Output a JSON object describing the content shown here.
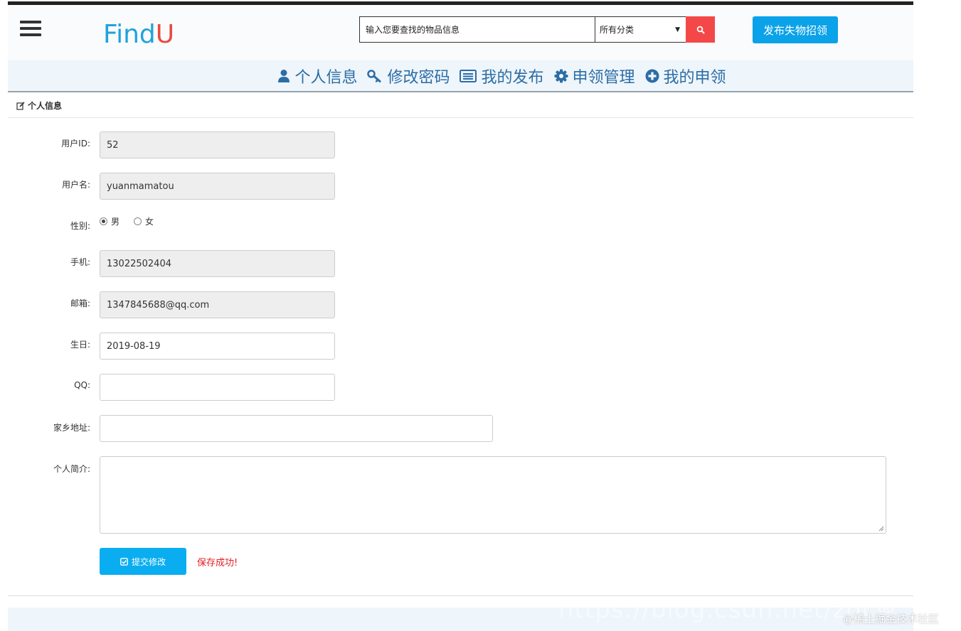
{
  "header": {
    "logo_find": "Find",
    "logo_u": "U",
    "search_placeholder": "输入您要查找的物品信息",
    "category_selected": "所有分类",
    "publish_button": "发布失物招领"
  },
  "nav": {
    "items": [
      {
        "label": "个人信息",
        "icon": "user-icon"
      },
      {
        "label": "修改密码",
        "icon": "key-icon"
      },
      {
        "label": "我的发布",
        "icon": "list-icon"
      },
      {
        "label": "申领管理",
        "icon": "gear-icon"
      },
      {
        "label": "我的申领",
        "icon": "plus-circle-icon"
      }
    ]
  },
  "section": {
    "title": "个人信息"
  },
  "form": {
    "user_id": {
      "label": "用户ID:",
      "value": "52"
    },
    "username": {
      "label": "用户名:",
      "value": "yuanmamatou"
    },
    "gender": {
      "label": "性别:",
      "options": [
        "男",
        "女"
      ],
      "selected": "男"
    },
    "phone": {
      "label": "手机:",
      "value": "13022502404"
    },
    "email": {
      "label": "邮箱:",
      "value": "1347845688@qq.com"
    },
    "birthday": {
      "label": "生日:",
      "value": "2019-08-19"
    },
    "qq": {
      "label": "QQ:",
      "value": ""
    },
    "hometown": {
      "label": "家乡地址:",
      "value": ""
    },
    "bio": {
      "label": "个人简介:",
      "value": ""
    },
    "submit_label": "提交修改",
    "save_status": "保存成功!"
  },
  "watermark": {
    "url": "https://blog.csdn.net/zgcw",
    "site": "@稀土掘金技术社区"
  },
  "colors": {
    "accent": "#0aa2e8",
    "logo_find": "#1fa3dc",
    "logo_u": "#e84a3d",
    "search_button": "#f44848",
    "nav_text": "#2c6da4",
    "status_text": "#e02020"
  }
}
